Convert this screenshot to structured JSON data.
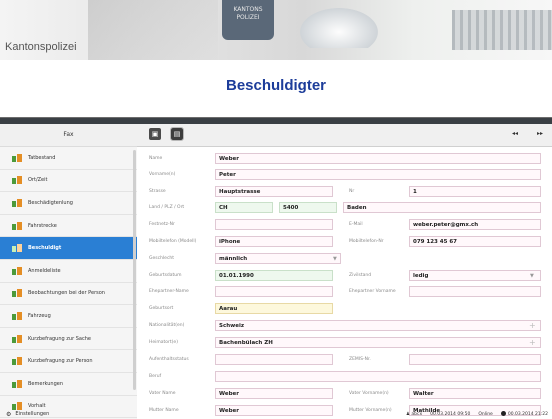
{
  "banner": {
    "brand": "Kantonspolizei",
    "badge_text": "KANTONS POLIZEI"
  },
  "page_title": "Beschuldigter",
  "sidebar": {
    "header": "Fax",
    "items": [
      {
        "label": "Tatbestand"
      },
      {
        "label": "Ort/Zeit"
      },
      {
        "label": "Beschädigtenlung"
      },
      {
        "label": "Fahrstrecke"
      },
      {
        "label": "Beschuldigt",
        "active": true
      },
      {
        "label": "Anmeldeliste"
      },
      {
        "label": "Beobachtungen bei der Person"
      },
      {
        "label": "Fahrzeug"
      },
      {
        "label": "Kurzbefragung zur Sache"
      },
      {
        "label": "Kurzbefragung zur Person"
      },
      {
        "label": "Bemerkungen"
      },
      {
        "label": "Vorhalt"
      }
    ],
    "settings": "Einstellungen"
  },
  "toolbar": {
    "prev": "◂◂",
    "next": "▸▸"
  },
  "form": {
    "name_label": "Name",
    "name": "Weber",
    "vorname_label": "Vorname(n)",
    "vorname": "Peter",
    "strasse_label": "Strasse",
    "strasse": "Hauptstrasse",
    "nr_label": "Nr",
    "nr": "1",
    "land_label": "Land / PLZ / Ort",
    "land": "CH",
    "plz": "5400",
    "ort": "Baden",
    "festnetz_label": "Festnetz-Nr",
    "email_label": "E-Mail",
    "email": "weber.peter@gmx.ch",
    "mobil_typ_label": "Mobiltelefon (Modell)",
    "mobil_typ": "iPhone",
    "mobil_nr_label": "Mobiltelefon-Nr",
    "mobil_nr": "079 123 45 67",
    "geschlecht_label": "Geschlecht",
    "geschlecht": "männlich",
    "geburtsdatum_label": "Geburtsdatum",
    "geburtsdatum": "01.01.1990",
    "zivilstand_label": "Zivilstand",
    "zivilstand": "ledig",
    "ledig_name_label": "Ehepartner-Name",
    "ehepartner_vorname_label": "Ehepartner Vorname",
    "geburtsort_label": "Geburtsort",
    "geburtsort": "Aarau",
    "nationalitaet_label": "Nationalität(en)",
    "nationalitaet": "Schweiz",
    "heimatort_label": "Heimatort(e)",
    "heimatort": "Bachenbülach ZH",
    "aufenthalt_label": "Aufenthaltsstatus",
    "zemis_label": "ZEMIS-Nr.",
    "beruf_label": "Beruf",
    "vater_label": "Vater Name",
    "vater": "Weber",
    "vater_vorname_label": "Vater Vorname(n)",
    "vater_vorname": "Walter",
    "mutter_label": "Mutter Name",
    "mutter": "Weber",
    "mutter_vorname_label": "Mutter Vorname(n)",
    "mutter_vorname": "Mathilde"
  },
  "status": {
    "user": "abcx",
    "time1": "00.03.2014 09:50",
    "mode": "Online",
    "time2": "00.03.2014 21:22"
  }
}
